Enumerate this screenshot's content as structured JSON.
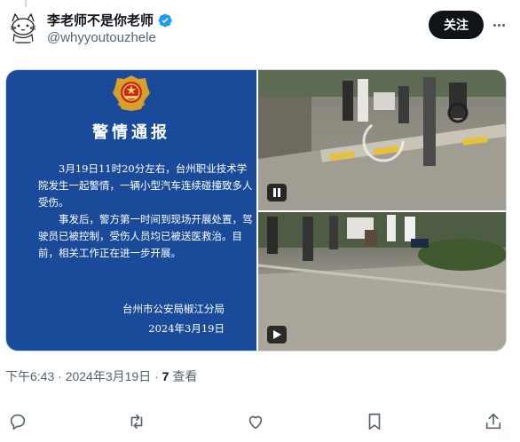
{
  "author": {
    "display_name": "李老师不是你老师",
    "handle": "@whyyoutouzhele",
    "verified": true
  },
  "header": {
    "follow_label": "关注"
  },
  "notice": {
    "title": "警情通报",
    "paragraph1": "3月19日11时20分左右，台州职业技术学院发生一起警情，一辆小型汽车连续碰撞致多人受伤。",
    "paragraph2": "事发后，警方第一时间到现场开展处置，驾驶员已被控制，受伤人员均已被送医救治。目前，相关工作正在进一步开展。",
    "issuer": "台州市公安局椒江分局",
    "date": "2024年3月19日"
  },
  "meta": {
    "time": "下午6:43",
    "separator1": " · ",
    "date": "2024年3月19日",
    "separator2": " · ",
    "views_count": "7",
    "views_label": " 查看"
  },
  "icons": {
    "reply": "reply-icon",
    "retweet": "retweet-icon",
    "like": "like-icon",
    "bookmark": "bookmark-icon",
    "share": "share-icon",
    "play": "play-icon",
    "pause": "pause-icon"
  },
  "colors": {
    "notice_bg": "#1a4b9a",
    "verified": "#1d9bf0",
    "follow_bg": "#0f1419",
    "muted": "#536471"
  }
}
